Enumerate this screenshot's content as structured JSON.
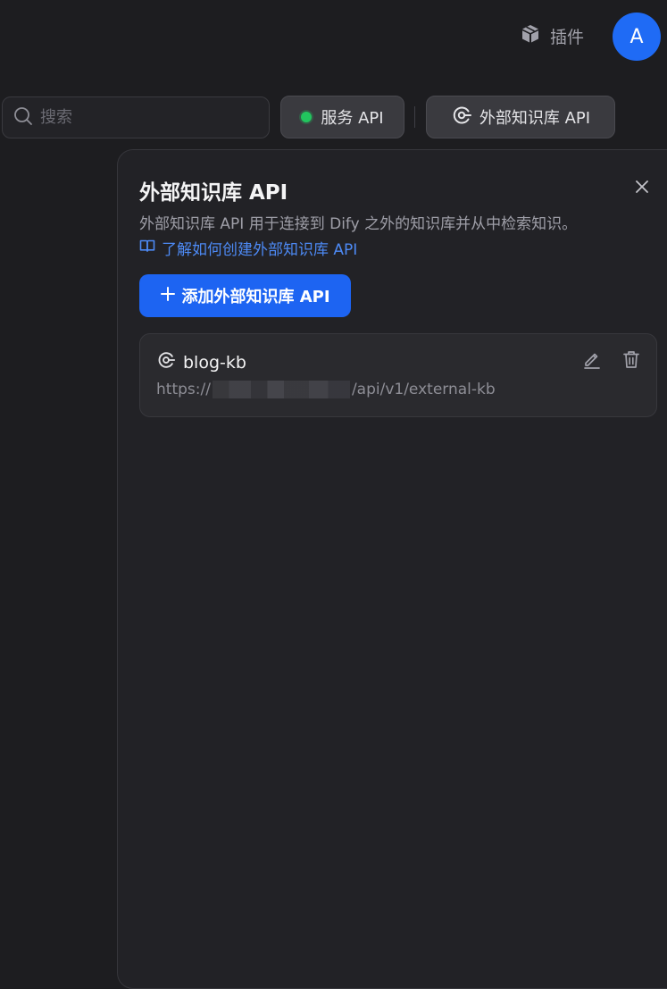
{
  "header": {
    "plugins_label": "插件",
    "avatar_initial": "A"
  },
  "toolbar": {
    "search_placeholder": "搜索",
    "service_api_label": "服务 API",
    "external_api_label": "外部知识库 API"
  },
  "panel": {
    "title": "外部知识库 API",
    "description": "外部知识库 API 用于连接到 Dify 之外的知识库并从中检索知识。",
    "learn_link": "了解如何创建外部知识库 API",
    "add_button": "添加外部知识库 API",
    "items": [
      {
        "name": "blog-kb",
        "url_prefix": "https://",
        "url_suffix": "/api/v1/external-kb"
      }
    ]
  },
  "colors": {
    "accent": "#1d64f2",
    "link": "#4d8af5",
    "status_online": "#22c55e"
  },
  "icons": {
    "plugins": "cube-icon",
    "search": "search-icon",
    "external_api": "external-api-icon",
    "close": "close-icon",
    "learn": "book-icon",
    "add": "plus-icon",
    "edit": "pencil-icon",
    "delete": "trash-icon"
  }
}
